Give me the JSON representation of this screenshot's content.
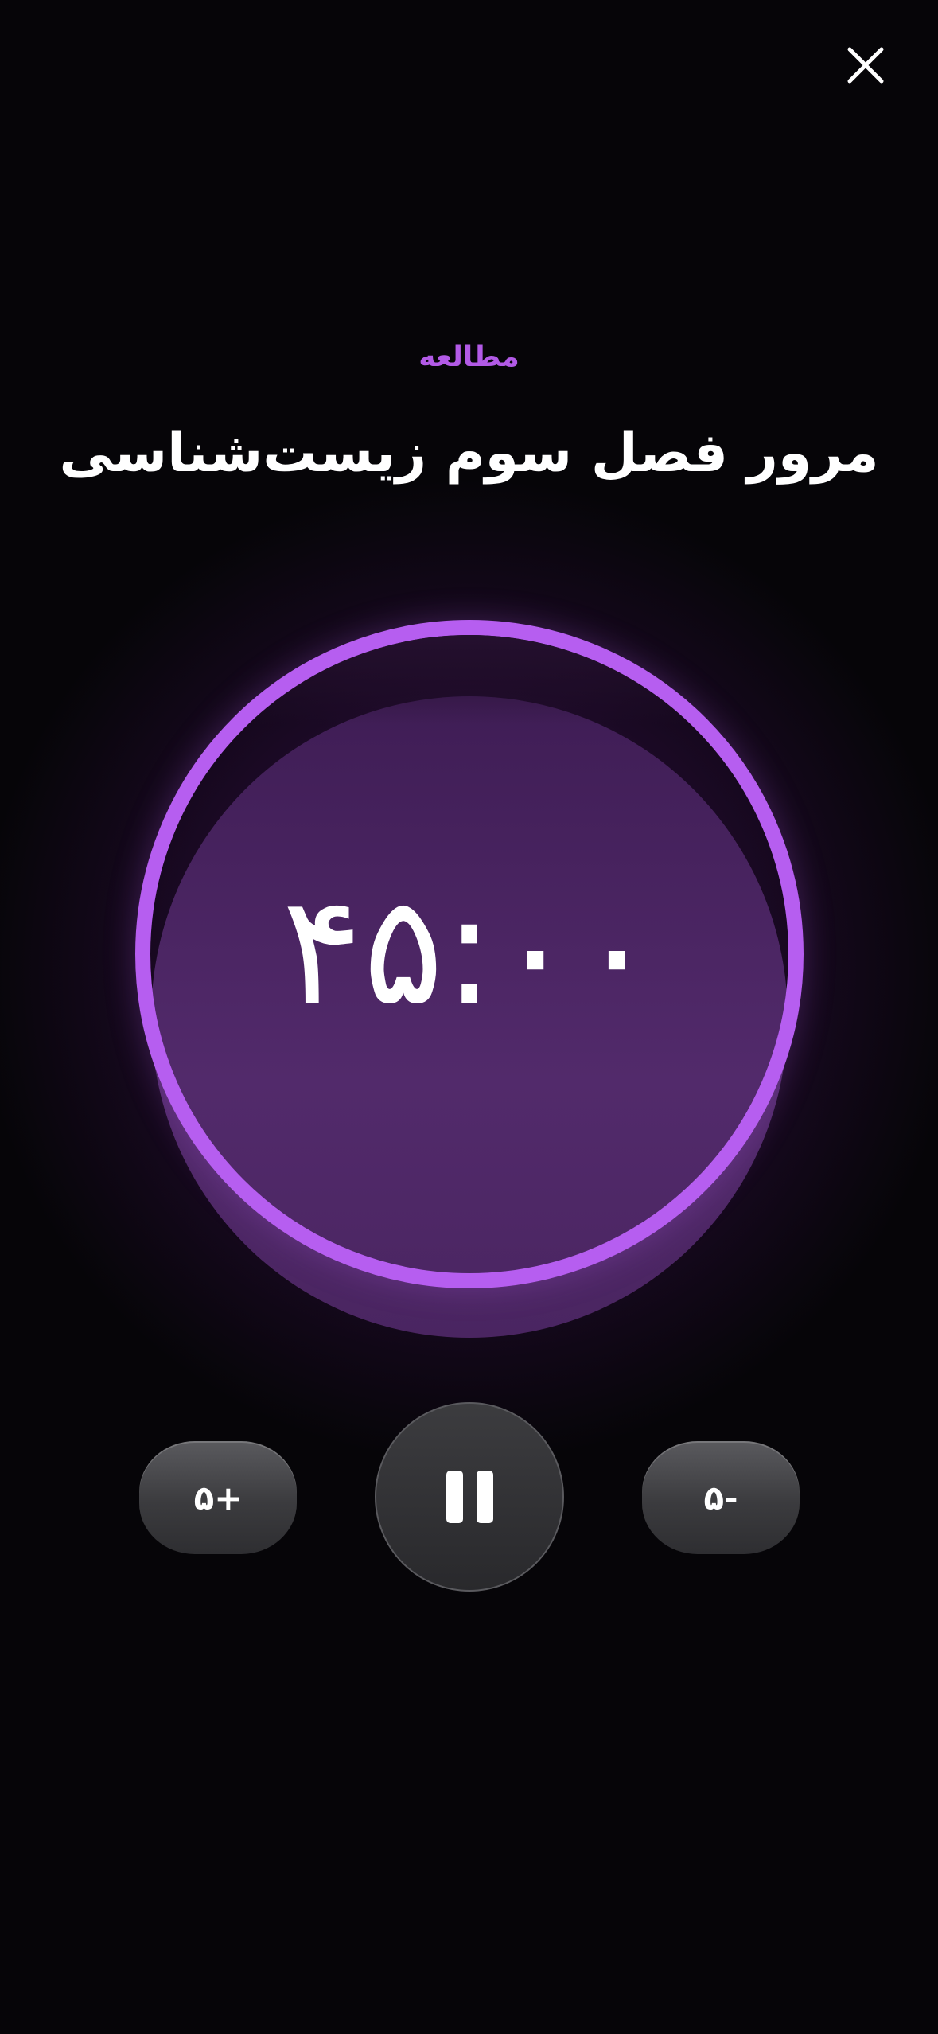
{
  "header": {
    "close_icon": "close-icon"
  },
  "session": {
    "category": "مطالعه",
    "title": "مرور فصل سوم زیست‌شناسی"
  },
  "timer": {
    "display": "۴۵:۰۰",
    "state": "running"
  },
  "controls": {
    "add_label": "۵+",
    "subtract_label": "۵-",
    "pause_icon": "pause-icon"
  },
  "colors": {
    "accent": "#b65ef0",
    "category_text": "#b25ae6",
    "background": "#060508",
    "button": "#3b3b3e"
  }
}
